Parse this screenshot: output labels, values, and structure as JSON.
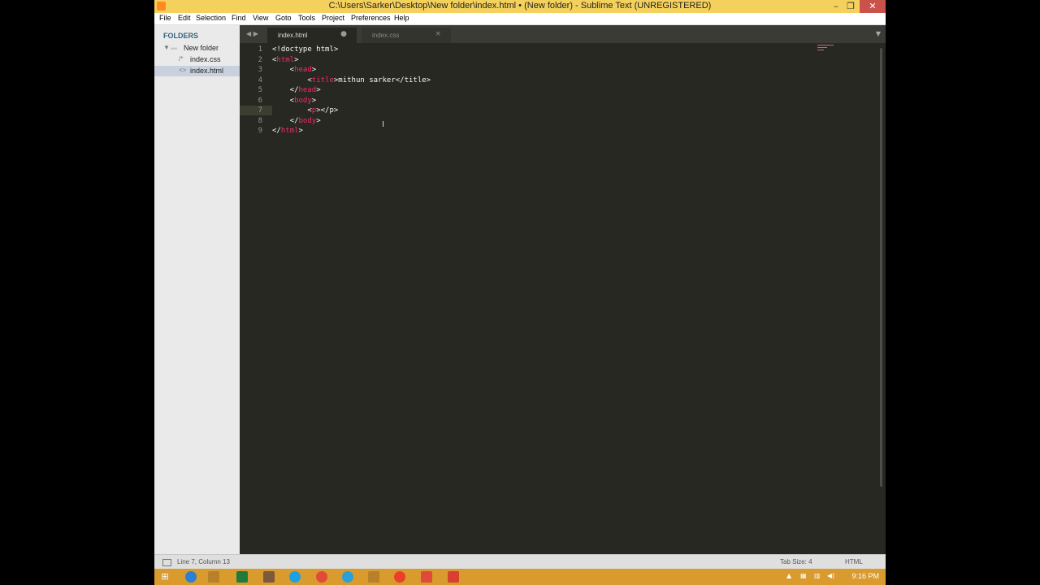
{
  "window": {
    "title": "C:\\Users\\Sarker\\Desktop\\New folder\\index.html • (New folder) - Sublime Text (UNREGISTERED)",
    "controls": {
      "minimize": "–",
      "maximize": "❐",
      "close": "✕"
    }
  },
  "menu": [
    "File",
    "Edit",
    "Selection",
    "Find",
    "View",
    "Goto",
    "Tools",
    "Project",
    "Preferences",
    "Help"
  ],
  "sidebar": {
    "header": "FOLDERS",
    "folder": "New folder",
    "files": [
      {
        "name": "index.css",
        "icon": "/*"
      },
      {
        "name": "index.html",
        "icon": "<>"
      }
    ]
  },
  "tabs": [
    {
      "name": "index.html",
      "marker": "●"
    },
    {
      "name": "index.css",
      "marker": "×"
    }
  ],
  "nav": {
    "arrows": "◀ ▶",
    "dropdown": "▼"
  },
  "editor": {
    "line_numbers": [
      "1",
      "2",
      "3",
      "4",
      "5",
      "6",
      "7",
      "8",
      "9"
    ],
    "lines": [
      {
        "pre": "<!doctype html>",
        "tag": "",
        "post": ""
      },
      {
        "pre": "<",
        "tag": "html",
        "post": ">"
      },
      {
        "pre": "    <",
        "tag": "head",
        "post": ">"
      },
      {
        "pre": "        <",
        "tag": "title",
        "post": ">mithun sarker</title>"
      },
      {
        "pre": "    </",
        "tag": "head",
        "post": ">"
      },
      {
        "pre": "    <",
        "tag": "body",
        "post": ">"
      },
      {
        "pre": "        <",
        "tag": "p",
        "post": "></p>"
      },
      {
        "pre": "    </",
        "tag": "body",
        "post": ">"
      },
      {
        "pre": "</",
        "tag": "html",
        "post": ">"
      }
    ],
    "current_line": 7
  },
  "status": {
    "position": "Line 7, Column 13",
    "tab_size": "Tab Size: 4",
    "syntax": "HTML"
  },
  "taskbar": {
    "clock": "9:16 PM"
  },
  "colors": {
    "title_bar": "#f4d15c",
    "editor_bg": "#272822",
    "tag": "#f92672",
    "taskbar": "#d99a2e"
  }
}
